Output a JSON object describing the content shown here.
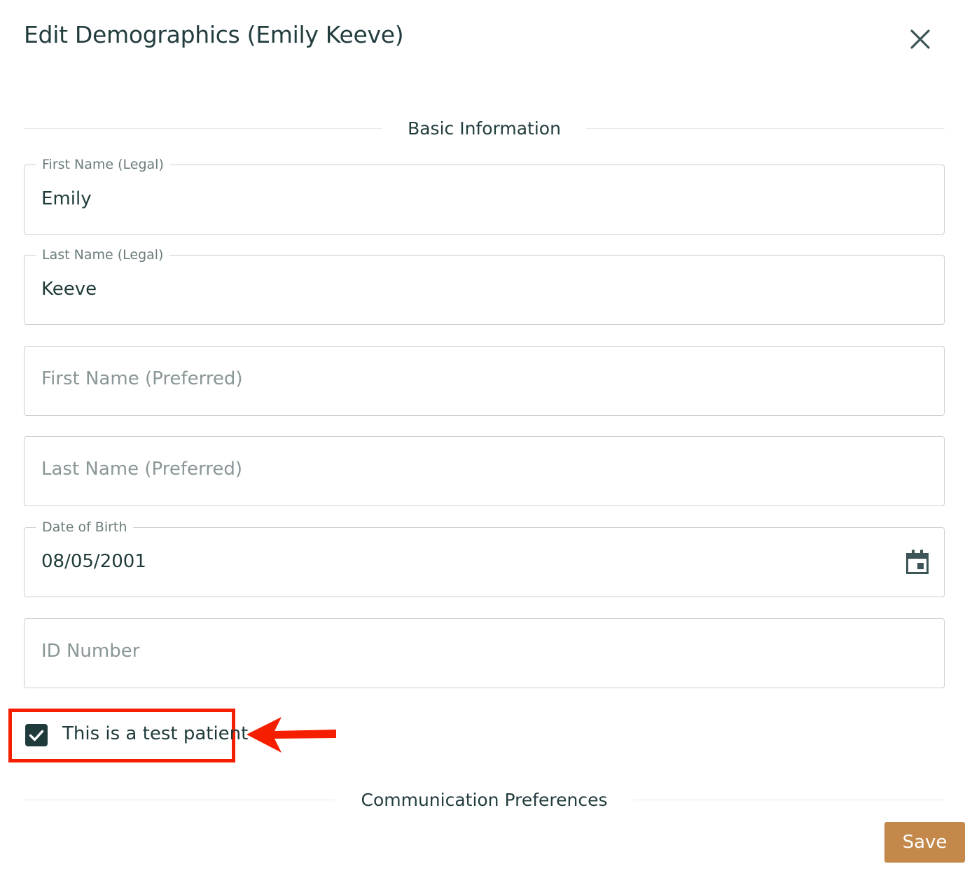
{
  "dialog": {
    "title": "Edit Demographics (Emily Keeve)",
    "close_icon": "close-icon"
  },
  "sections": {
    "basic": "Basic Information",
    "communication": "Communication Preferences"
  },
  "fields": {
    "first_name_legal": {
      "label": "First Name (Legal)",
      "value": "Emily"
    },
    "last_name_legal": {
      "label": "Last Name (Legal)",
      "value": "Keeve"
    },
    "first_name_preferred": {
      "placeholder": "First Name (Preferred)"
    },
    "last_name_preferred": {
      "placeholder": "Last Name (Preferred)"
    },
    "date_of_birth": {
      "label": "Date of Birth",
      "value": "08/05/2001",
      "icon": "calendar-icon"
    },
    "id_number": {
      "placeholder": "ID Number"
    }
  },
  "test_patient": {
    "label": "This is a test patient",
    "checked": true
  },
  "actions": {
    "save_label": "Save"
  },
  "colors": {
    "accent": "#c4884a",
    "text": "#1f3a3a",
    "annotation": "#f51f00"
  }
}
